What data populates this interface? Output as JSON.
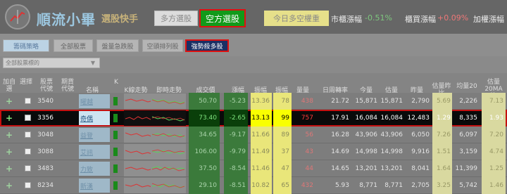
{
  "header": {
    "app_name": "順流小畢",
    "app_sub": "選股快手",
    "btn_long": "多方選股",
    "btn_short": "空方選股",
    "btn_today": "今日多空權重",
    "index_label": "市櫃漲幅",
    "index_val": "-0.51%",
    "futures_label": "櫃買漲幅",
    "futures_val": "+0.09%",
    "weighted_label": "加權漲幅"
  },
  "tabs": [
    "籌碼策略",
    "全部股票",
    "盤量急跌股",
    "空頭排列股",
    "強勢殺多股"
  ],
  "filter": {
    "value": "全部股票標的",
    "arrow": "▼"
  },
  "columns": {
    "add": "加自選",
    "mark": "選擇",
    "code": "股票代號",
    "futures_code": "期貨代號",
    "name": "名稱",
    "k": "K",
    "ktrend": "K線走勢",
    "intraday": "即時走勢",
    "price": "成交價",
    "change": "漲幅",
    "amp1": "振幅",
    "amp2": "振幅",
    "volume": "量量",
    "turnover": "日周轉率",
    "today": "今量",
    "est": "估量",
    "prev": "昨量",
    "ratio": "估量昨比",
    "avg20": "均量20",
    "ratio20": "估量20MA比"
  },
  "rows": [
    {
      "code": "3540",
      "name": "曜越",
      "price": "50.70",
      "change": "-5.23",
      "amp1": "13.36",
      "amp2": "78",
      "vol": "438",
      "turnover": "21.72",
      "today": "15,871",
      "est": "15,871",
      "prev": "2,790",
      "ratio": "5.69",
      "avg20": "2,226",
      "ratio20": "7.13"
    },
    {
      "code": "3356",
      "name": "奇偶",
      "price": "73.40",
      "change": "-2.65",
      "amp1": "13.13",
      "amp2": "99",
      "vol": "757",
      "turnover": "17.91",
      "today": "16,084",
      "est": "16,084",
      "prev": "12,483",
      "ratio": "1.29",
      "avg20": "8,335",
      "ratio20": "1.93"
    },
    {
      "code": "3048",
      "name": "益登",
      "price": "34.65",
      "change": "-9.17",
      "amp1": "11.66",
      "amp2": "89",
      "vol": "56",
      "turnover": "16.28",
      "today": "43,906",
      "est": "43,906",
      "prev": "6,050",
      "ratio": "7.26",
      "avg20": "6,097",
      "ratio20": "7.20"
    },
    {
      "code": "3088",
      "name": "艾訊",
      "price": "106.00",
      "change": "-9.79",
      "amp1": "11.49",
      "amp2": "37",
      "vol": "43",
      "turnover": "14.69",
      "today": "14,998",
      "est": "14,998",
      "prev": "9,916",
      "ratio": "1.51",
      "avg20": "3,159",
      "ratio20": "4.74"
    },
    {
      "code": "3483",
      "name": "力致",
      "price": "37.50",
      "change": "-8.54",
      "amp1": "11.46",
      "amp2": "47",
      "vol": "44",
      "turnover": "14.65",
      "today": "13,201",
      "est": "13,201",
      "prev": "8,041",
      "ratio": "1.64",
      "avg20": "11,399",
      "ratio20": "1.25"
    },
    {
      "code": "8234",
      "name": "新漢",
      "price": "29.10",
      "change": "-8.51",
      "amp1": "10.82",
      "amp2": "65",
      "vol": "432",
      "turnover": "5.93",
      "today": "8,771",
      "est": "8,771",
      "prev": "2,705",
      "ratio": "3.25",
      "avg20": "5,742",
      "ratio20": "1.46"
    }
  ]
}
